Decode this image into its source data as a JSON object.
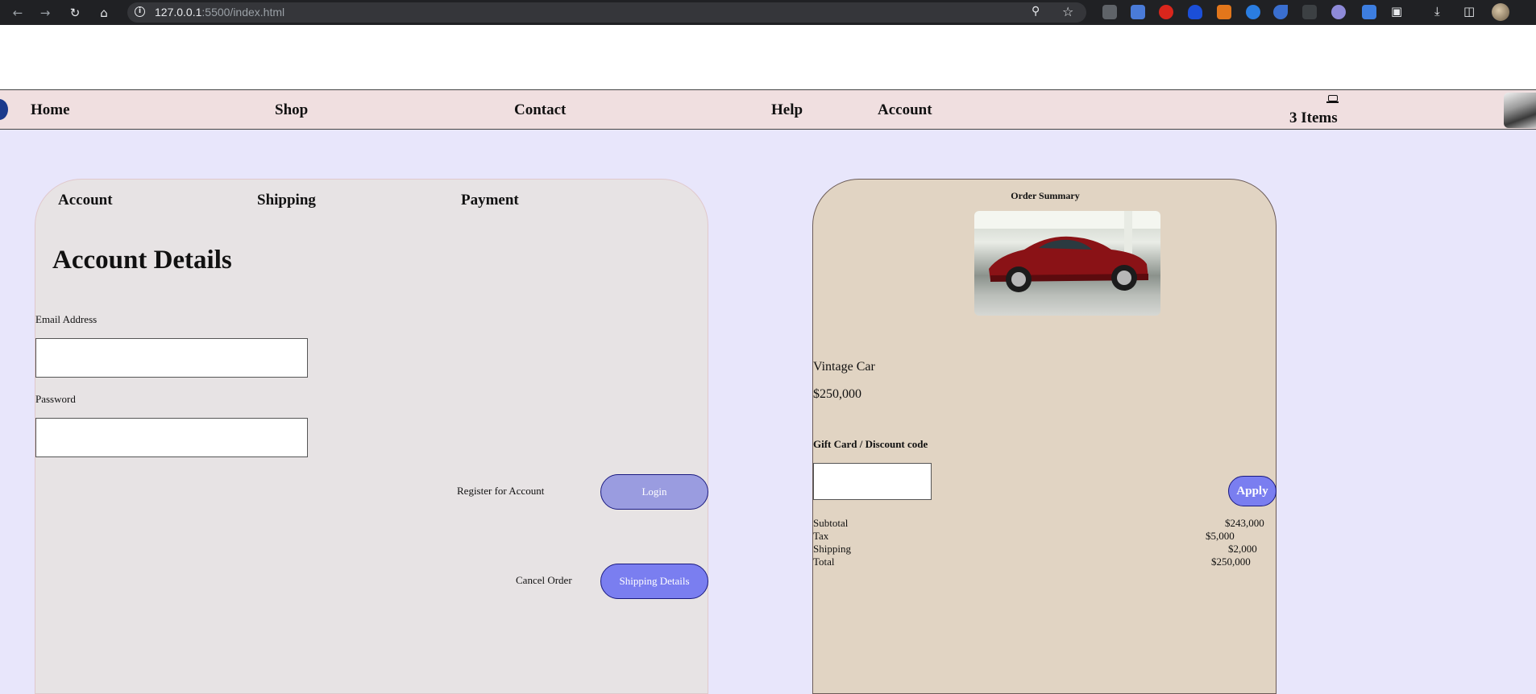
{
  "browser": {
    "url_host": "127.0.0.1",
    "url_rest": ":5500/index.html"
  },
  "nav": {
    "home": "Home",
    "shop": "Shop",
    "contact": "Contact",
    "help": "Help",
    "account": "Account",
    "cart_count": "3 Items"
  },
  "checkout": {
    "steps": [
      "Account",
      "Shipping",
      "Payment"
    ],
    "title": "Account Details",
    "email_label": "Email Address",
    "password_label": "Password",
    "register_link": "Register for Account",
    "login_button": "Login",
    "cancel_link": "Cancel Order",
    "shipping_button": "Shipping Details"
  },
  "summary": {
    "title": "Order Summary",
    "product_name": "Vintage Car",
    "product_price": "$250,000",
    "gift_label": "Gift Card / Discount code",
    "apply_button": "Apply",
    "totals": [
      {
        "label": "Subtotal",
        "value": "$243,000"
      },
      {
        "label": "Tax",
        "value": "$5,000"
      },
      {
        "label": "Shipping",
        "value": "$2,000"
      },
      {
        "label": "Total",
        "value": "$250,000"
      }
    ]
  }
}
